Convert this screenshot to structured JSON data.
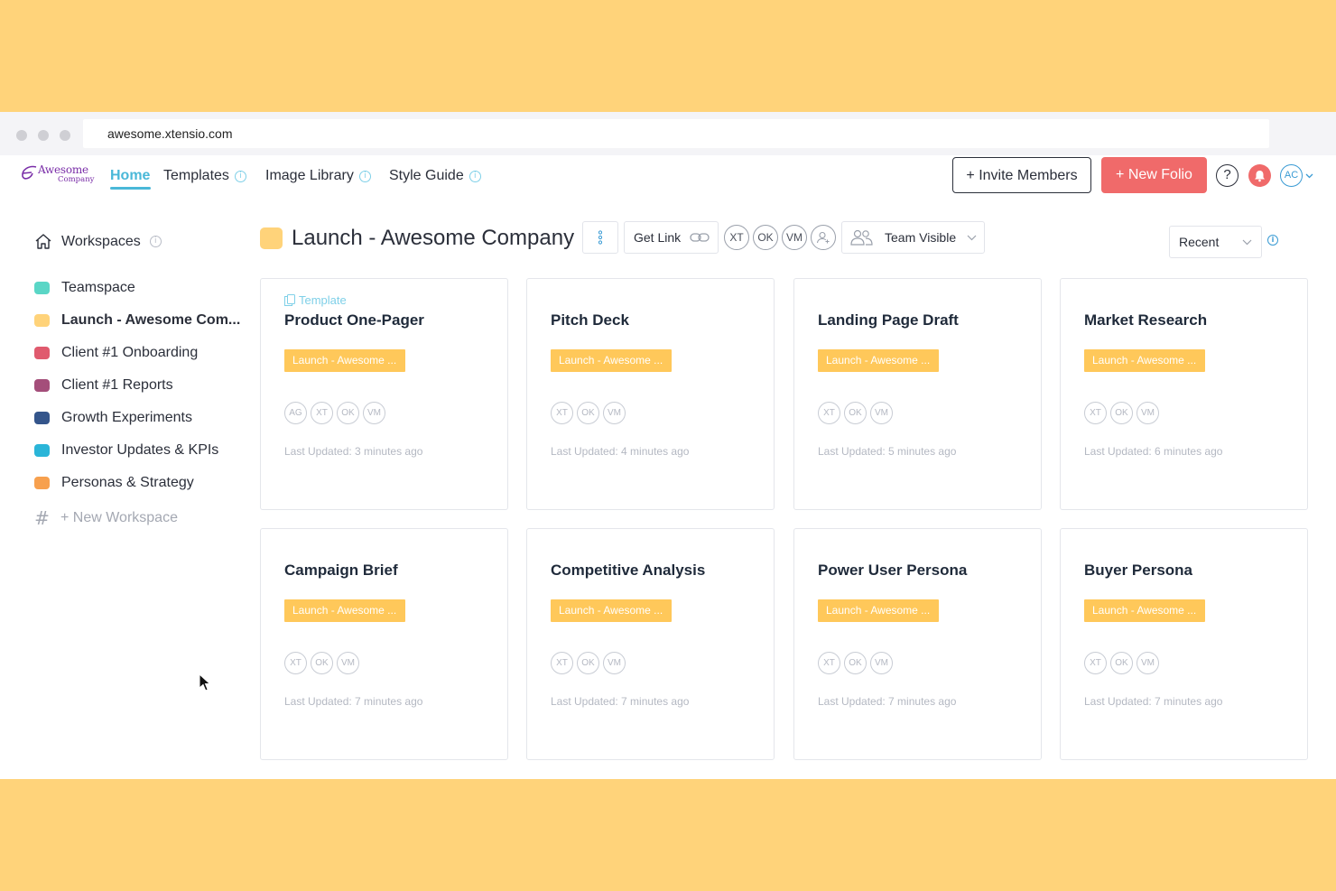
{
  "browser": {
    "url": "awesome.xtensio.com"
  },
  "brand": {
    "name": "Awesome",
    "sub": "Company",
    "color": "#7a2ea8"
  },
  "nav": {
    "home": "Home",
    "templates": "Templates",
    "image_library": "Image Library",
    "style_guide": "Style Guide",
    "info_glyph": "i"
  },
  "header_actions": {
    "invite": "+ Invite Members",
    "new_folio": "+ New Folio",
    "help": "?",
    "avatar": "AC"
  },
  "sidebar": {
    "workspaces_label": "Workspaces",
    "items": [
      {
        "label": "Teamspace",
        "color": "#5ad6c6"
      },
      {
        "label": "Launch - Awesome Com...",
        "color": "#FFD37A",
        "active": true
      },
      {
        "label": "Client #1 Onboarding",
        "color": "#e05a6e"
      },
      {
        "label": "Client #1 Reports",
        "color": "#a44e7a"
      },
      {
        "label": "Growth Experiments",
        "color": "#34558b"
      },
      {
        "label": "Investor Updates & KPIs",
        "color": "#2ab5d8"
      },
      {
        "label": "Personas & Strategy",
        "color": "#f7a04e"
      }
    ],
    "new_workspace": "+ New Workspace"
  },
  "workspace": {
    "title": "Launch - Awesome Company",
    "get_link": "Get Link",
    "members": [
      "XT",
      "OK",
      "VM"
    ],
    "visibility": "Team Visible",
    "sort": "Recent"
  },
  "cards": [
    {
      "template_label": "Template",
      "title": "Product One-Pager",
      "tag": "Launch - Awesome ...",
      "avatars": [
        "AG",
        "XT",
        "OK",
        "VM"
      ],
      "updated": "Last Updated: 3 minutes ago"
    },
    {
      "template_label": "",
      "title": "Pitch Deck",
      "tag": "Launch - Awesome ...",
      "avatars": [
        "XT",
        "OK",
        "VM"
      ],
      "updated": "Last Updated: 4 minutes ago"
    },
    {
      "template_label": "",
      "title": "Landing Page Draft",
      "tag": "Launch - Awesome ...",
      "avatars": [
        "XT",
        "OK",
        "VM"
      ],
      "updated": "Last Updated: 5 minutes ago"
    },
    {
      "template_label": "",
      "title": "Market Research",
      "tag": "Launch - Awesome ...",
      "avatars": [
        "XT",
        "OK",
        "VM"
      ],
      "updated": "Last Updated: 6 minutes ago"
    },
    {
      "template_label": "",
      "title": "Campaign Brief",
      "tag": "Launch - Awesome ...",
      "avatars": [
        "XT",
        "OK",
        "VM"
      ],
      "updated": "Last Updated: 7 minutes ago"
    },
    {
      "template_label": "",
      "title": "Competitive Analysis",
      "tag": "Launch - Awesome ...",
      "avatars": [
        "XT",
        "OK",
        "VM"
      ],
      "updated": "Last Updated: 7 minutes ago"
    },
    {
      "template_label": "",
      "title": "Power User Persona",
      "tag": "Launch - Awesome ...",
      "avatars": [
        "XT",
        "OK",
        "VM"
      ],
      "updated": "Last Updated: 7 minutes ago"
    },
    {
      "template_label": "",
      "title": "Buyer Persona",
      "tag": "Launch - Awesome ...",
      "avatars": [
        "XT",
        "OK",
        "VM"
      ],
      "updated": "Last Updated: 7 minutes ago"
    }
  ],
  "colors": {
    "accent": "#4ab8d8",
    "primary_button": "#f06a6a",
    "tag": "#FFC85A",
    "backdrop": "#FFD37A"
  }
}
